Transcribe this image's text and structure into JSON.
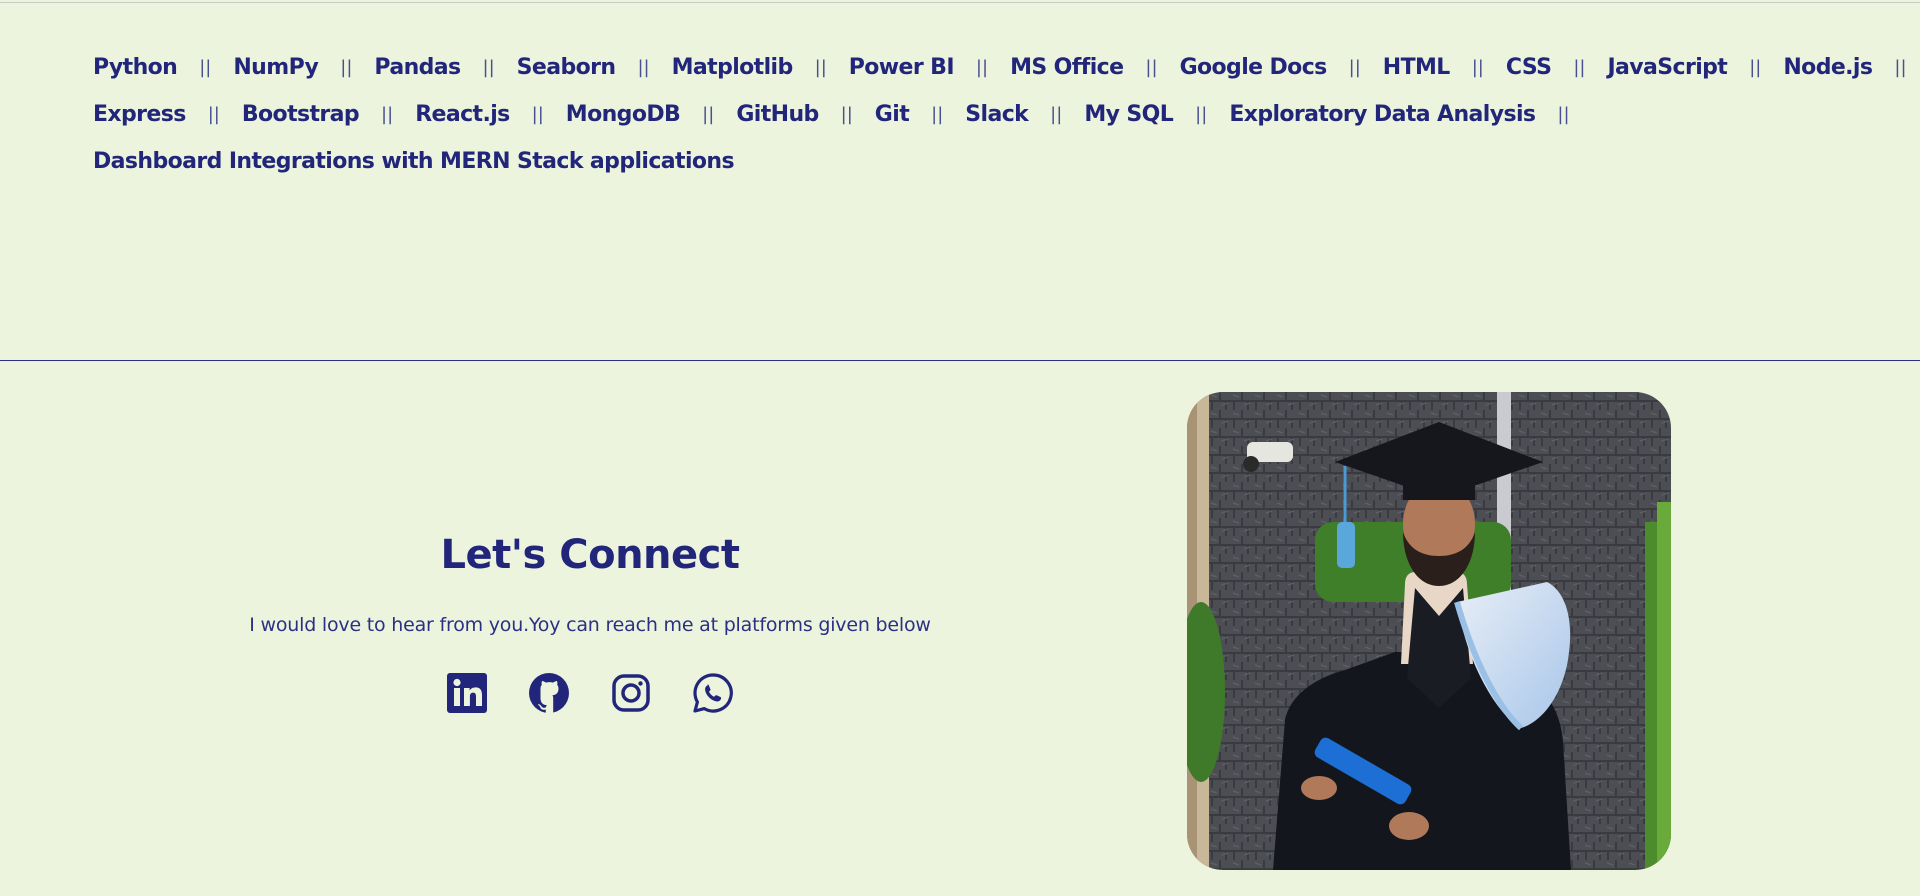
{
  "skills": {
    "separator": "||",
    "rows": [
      [
        "Python",
        "NumPy",
        "Pandas",
        "Seaborn",
        "Matplotlib",
        "Power BI",
        "MS Office",
        "Google Docs",
        "HTML",
        "CSS",
        "JavaScript",
        "Node.js"
      ],
      [
        "Express",
        "Bootstrap",
        "React.js",
        "MongoDB",
        "GitHub",
        "Git",
        "Slack",
        "My SQL",
        "Exploratory Data Analysis"
      ],
      [
        "Dashboard Integrations with MERN Stack applications"
      ]
    ]
  },
  "connect": {
    "title": "Let's Connect",
    "subtitle": "I would love to hear from you.Yoy can reach me at platforms given below",
    "socials": [
      {
        "name": "linkedin-icon"
      },
      {
        "name": "github-icon"
      },
      {
        "name": "instagram-icon"
      },
      {
        "name": "whatsapp-icon"
      }
    ]
  },
  "colors": {
    "background": "#edf4de",
    "accent": "#22267a"
  }
}
